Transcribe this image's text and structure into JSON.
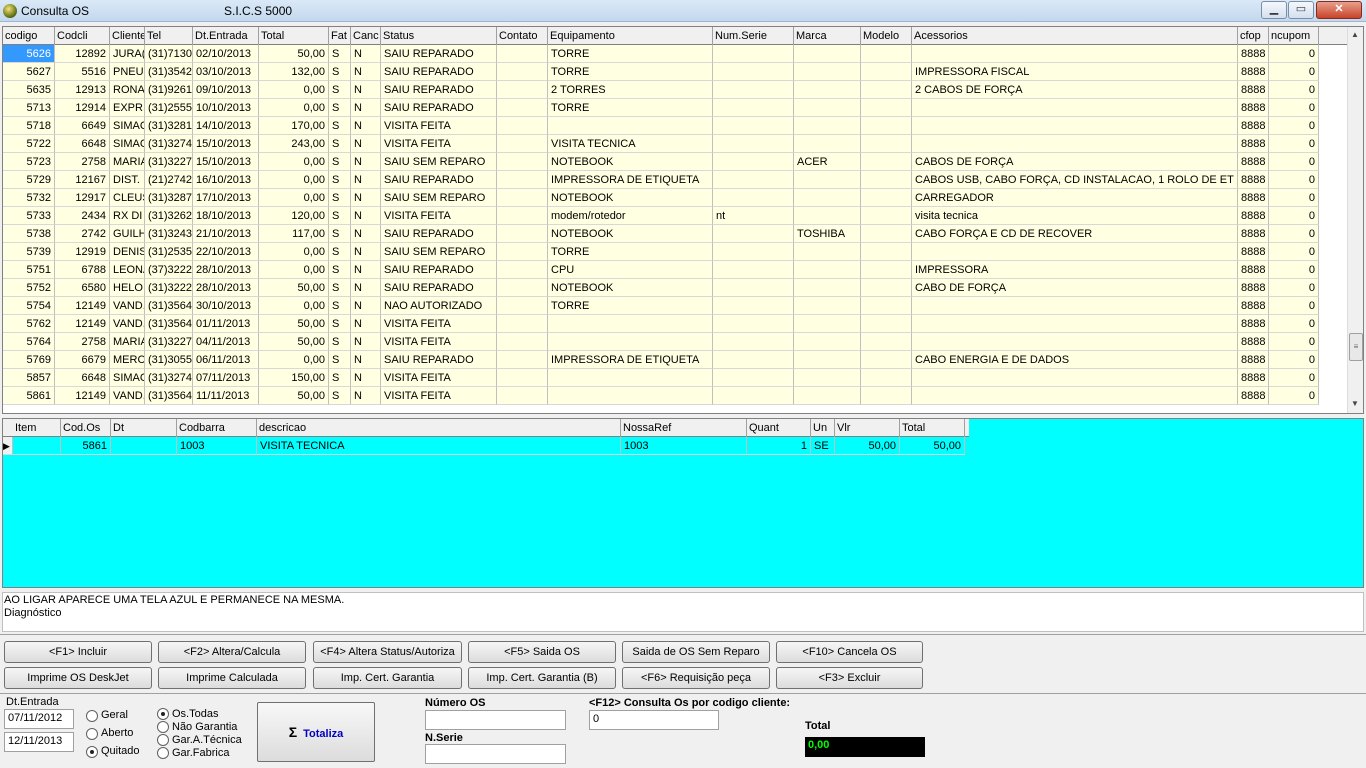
{
  "window": {
    "title": "Consulta OS",
    "subtitle": "S.I.C.S 5000",
    "min": "▁",
    "max": "▭",
    "close": "✕"
  },
  "grid": {
    "headers": [
      "codigo",
      "Codcli",
      "Cliente",
      "Tel",
      "Dt.Entrada",
      "Total",
      "Fat",
      "Canc",
      "Status",
      "Contato",
      "Equipamento",
      "Num.Serie",
      "Marca",
      "Modelo",
      "Acessorios",
      "cfop",
      "ncupom"
    ],
    "rows": [
      [
        "5626",
        "12892",
        "JURA(",
        "(31)7130",
        "02/10/2013",
        "50,00",
        "S",
        "N",
        "SAIU REPARADO",
        "",
        "TORRE",
        "",
        "",
        "",
        "",
        "8888",
        "0"
      ],
      [
        "5627",
        "5516",
        "PNEU",
        "(31)3542",
        "03/10/2013",
        "132,00",
        "S",
        "N",
        "SAIU REPARADO",
        "",
        "TORRE",
        "",
        "",
        "",
        "IMPRESSORA FISCAL",
        "8888",
        "0"
      ],
      [
        "5635",
        "12913",
        "RONA",
        "(31)9261",
        "09/10/2013",
        "0,00",
        "S",
        "N",
        "SAIU REPARADO",
        "",
        "2 TORRES",
        "",
        "",
        "",
        "2 CABOS DE FORÇA",
        "8888",
        "0"
      ],
      [
        "5713",
        "12914",
        "EXPRI",
        "(31)2555",
        "10/10/2013",
        "0,00",
        "S",
        "N",
        "SAIU REPARADO",
        "",
        "TORRE",
        "",
        "",
        "",
        "",
        "8888",
        "0"
      ],
      [
        "5718",
        "6649",
        "SIMAC",
        "(31)3281",
        "14/10/2013",
        "170,00",
        "S",
        "N",
        "VISITA FEITA",
        "",
        "",
        "",
        "",
        "",
        "",
        "8888",
        "0"
      ],
      [
        "5722",
        "6648",
        "SIMAC",
        "(31)3274",
        "15/10/2013",
        "243,00",
        "S",
        "N",
        "VISITA FEITA",
        "",
        "VISITA TECNICA",
        "",
        "",
        "",
        "",
        "8888",
        "0"
      ],
      [
        "5723",
        "2758",
        "MARIA",
        "(31)3227",
        "15/10/2013",
        "0,00",
        "S",
        "N",
        "SAIU SEM REPARO",
        "",
        "NOTEBOOK",
        "",
        "ACER",
        "",
        "CABOS DE FORÇA",
        "8888",
        "0"
      ],
      [
        "5729",
        "12167",
        "DIST.",
        "(21)2742",
        "16/10/2013",
        "0,00",
        "S",
        "N",
        "SAIU REPARADO",
        "",
        "IMPRESSORA DE ETIQUETA",
        "",
        "",
        "",
        "CABOS USB, CABO FORÇA, CD INSTALACAO, 1 ROLO DE ET",
        "8888",
        "0"
      ],
      [
        "5732",
        "12917",
        "CLEUS",
        "(31)3287",
        "17/10/2013",
        "0,00",
        "S",
        "N",
        "SAIU SEM REPARO",
        "",
        "NOTEBOOK",
        "",
        "",
        "",
        "CARREGADOR",
        "8888",
        "0"
      ],
      [
        "5733",
        "2434",
        "RX DI",
        "(31)3262",
        "18/10/2013",
        "120,00",
        "S",
        "N",
        "VISITA FEITA",
        "",
        "modem/rotedor",
        "nt",
        "",
        "",
        "visita tecnica",
        "8888",
        "0"
      ],
      [
        "5738",
        "2742",
        "GUILH",
        "(31)3243",
        "21/10/2013",
        "117,00",
        "S",
        "N",
        "SAIU REPARADO",
        "",
        "NOTEBOOK",
        "",
        "TOSHIBA",
        "",
        "CABO FORÇA E CD DE RECOVER",
        "8888",
        "0"
      ],
      [
        "5739",
        "12919",
        "DENIS",
        "(31)2535",
        "22/10/2013",
        "0,00",
        "S",
        "N",
        "SAIU SEM REPARO",
        "",
        "TORRE",
        "",
        "",
        "",
        "",
        "8888",
        "0"
      ],
      [
        "5751",
        "6788",
        "LEONA",
        "(37)3222",
        "28/10/2013",
        "0,00",
        "S",
        "N",
        "SAIU REPARADO",
        "",
        "CPU",
        "",
        "",
        "",
        "IMPRESSORA",
        "8888",
        "0"
      ],
      [
        "5752",
        "6580",
        "HELOI",
        "(31)3222",
        "28/10/2013",
        "50,00",
        "S",
        "N",
        "SAIU REPARADO",
        "",
        "NOTEBOOK",
        "",
        "",
        "",
        "CABO DE FORÇA",
        "8888",
        "0"
      ],
      [
        "5754",
        "12149",
        "VAND.",
        "(31)3564",
        "30/10/2013",
        "0,00",
        "S",
        "N",
        "NAO AUTORIZADO",
        "",
        "TORRE",
        "",
        "",
        "",
        "",
        "8888",
        "0"
      ],
      [
        "5762",
        "12149",
        "VAND.",
        "(31)3564",
        "01/11/2013",
        "50,00",
        "S",
        "N",
        "VISITA FEITA",
        "",
        "",
        "",
        "",
        "",
        "",
        "8888",
        "0"
      ],
      [
        "5764",
        "2758",
        "MARIA",
        "(31)3227",
        "04/11/2013",
        "50,00",
        "S",
        "N",
        "VISITA FEITA",
        "",
        "",
        "",
        "",
        "",
        "",
        "8888",
        "0"
      ],
      [
        "5769",
        "6679",
        "MERC",
        "(31)3055",
        "06/11/2013",
        "0,00",
        "S",
        "N",
        "SAIU REPARADO",
        "",
        "IMPRESSORA  DE ETIQUETA",
        "",
        "",
        "",
        "CABO ENERGIA E DE DADOS",
        "8888",
        "0"
      ],
      [
        "5857",
        "6648",
        "SIMAC",
        "(31)3274",
        "07/11/2013",
        "150,00",
        "S",
        "N",
        "VISITA FEITA",
        "",
        "",
        "",
        "",
        "",
        "",
        "8888",
        "0"
      ],
      [
        "5861",
        "12149",
        "VAND.",
        "(31)3564",
        "11/11/2013",
        "50,00",
        "S",
        "N",
        "VISITA FEITA",
        "",
        "",
        "",
        "",
        "",
        "",
        "8888",
        "0"
      ]
    ]
  },
  "items": {
    "headers": [
      "Item",
      "Cod.Os",
      "Dt",
      "Codbarra",
      "descricao",
      "NossaRef",
      "Quant",
      "Un",
      "Vlr",
      "Total"
    ],
    "row": [
      "",
      "5861",
      "",
      "1003",
      "VISITA TECNICA",
      "1003",
      "1",
      "SE",
      "50,00",
      "50,00"
    ],
    "indicator": "▶"
  },
  "description": {
    "line1": "AO LIGAR APARECE UMA TELA AZUL  E PERMANECE NA MESMA.",
    "line2": "Diagnóstico"
  },
  "buttons": {
    "incluir": "<F1> Incluir",
    "altera": "<F2> Altera/Calcula",
    "status": "<F4> Altera Status/Autoriza",
    "saida": "<F5> Saida OS",
    "sem_reparo": "Saida de OS Sem Reparo",
    "cancela": "<F10> Cancela OS",
    "deskjet": "Imprime OS DeskJet",
    "calculada": "Imprime Calculada",
    "cert": "Imp. Cert. Garantia",
    "cert_b": "Imp. Cert. Garantia (B)",
    "requisicao": "<F6> Requisição peça",
    "excluir": "<F3> Excluir"
  },
  "filters": {
    "date_label": "Dt.Entrada",
    "date_from": "07/11/2012",
    "date_to": "12/11/2013",
    "geral": "Geral",
    "aberto": "Aberto",
    "quitado": "Quitado",
    "todas": "Os.Todas",
    "nao_garantia": "Não Garantia",
    "gar_tecnica": "Gar.A.Técnica",
    "gar_fabrica": "Gar.Fabrica",
    "totaliza_label": "Totaliza",
    "totaliza_icon": "Σ",
    "numero_os_label": "Número OS",
    "numero_os": "",
    "nserie_label": "N.Serie",
    "nserie": "",
    "f12_label": "<F12> Consulta Os por codigo cliente:",
    "f12_value": "0",
    "total_label": "Total",
    "total_value": "0,00"
  }
}
